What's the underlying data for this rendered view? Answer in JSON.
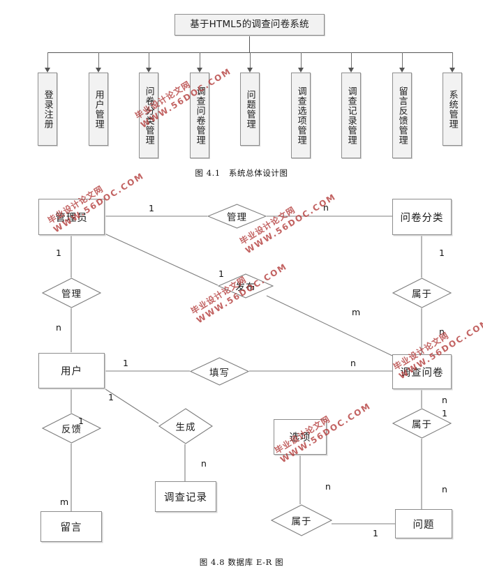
{
  "figure1": {
    "root": {
      "label": "基于HTML5的调查问卷系统"
    },
    "children": [
      {
        "label": "登录注册"
      },
      {
        "label": "用户管理"
      },
      {
        "label": "问卷分类管理"
      },
      {
        "label": "调查问卷管理"
      },
      {
        "label": "问题管理"
      },
      {
        "label": "调查选项管理"
      },
      {
        "label": "调查记录管理"
      },
      {
        "label": "留言反馈管理"
      },
      {
        "label": "系统管理"
      }
    ],
    "caption": "图 4.1　系统总体设计图"
  },
  "figure2": {
    "caption": "图 4.8 数据库 E-R 图",
    "entities": [
      {
        "label": "管理员"
      },
      {
        "label": "问卷分类"
      },
      {
        "label": "用户"
      },
      {
        "label": "调查问卷"
      },
      {
        "label": "调查记录"
      },
      {
        "label": "留言"
      },
      {
        "label": "选项"
      },
      {
        "label": "问题"
      }
    ],
    "relationships": [
      {
        "label": "管理"
      },
      {
        "label": "管理"
      },
      {
        "label": "发布"
      },
      {
        "label": "属于"
      },
      {
        "label": "填写"
      },
      {
        "label": "生成"
      },
      {
        "label": "反馈"
      },
      {
        "label": "属于"
      },
      {
        "label": "属于"
      }
    ],
    "cardinalities": [
      {
        "value": "1"
      },
      {
        "value": "n"
      },
      {
        "value": "1"
      },
      {
        "value": "n"
      },
      {
        "value": "1"
      },
      {
        "value": "1"
      },
      {
        "value": "m"
      },
      {
        "value": "n"
      },
      {
        "value": "1"
      },
      {
        "value": "n"
      },
      {
        "value": "1"
      },
      {
        "value": "1"
      },
      {
        "value": "n"
      },
      {
        "value": "m"
      },
      {
        "value": "n"
      },
      {
        "value": "1"
      },
      {
        "value": "n"
      },
      {
        "value": "n"
      },
      {
        "value": "1"
      }
    ]
  },
  "watermark": {
    "line1": "毕业设计论文网",
    "line2": "WWW.56DOC.COM",
    "color": "#b5403f"
  }
}
